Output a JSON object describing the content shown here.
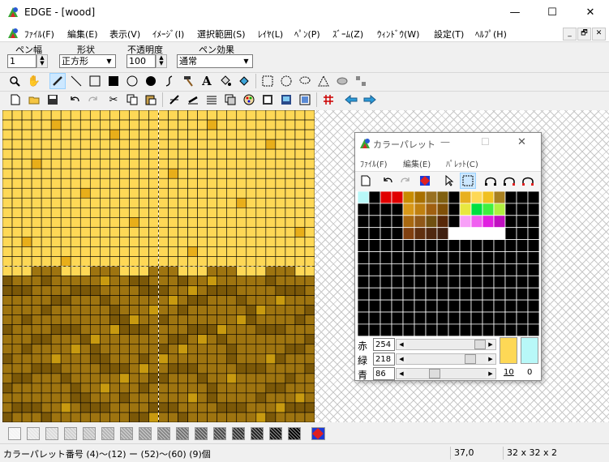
{
  "window": {
    "title": "EDGE - [wood]",
    "minimize_glyph": "—",
    "maximize_glyph": "☐",
    "close_glyph": "✕"
  },
  "menu": [
    "ﾌｧｲﾙ(F)",
    "編集(E)",
    "表示(V)",
    "ｲﾒｰｼﾞ(I)",
    "選択範囲(S)",
    "ﾚｲﾔ(L)",
    "ﾍﾟﾝ(P)",
    "ｽﾞｰﾑ(Z)",
    "ｳｨﾝﾄﾞｳ(W)",
    "設定(T)",
    "ﾍﾙﾌﾟ(H)"
  ],
  "mdi_buttons": [
    "_",
    "🗗",
    "✕"
  ],
  "settings": {
    "pen_width_label": "ペン幅",
    "pen_width_value": "1",
    "shape_label": "形状",
    "shape_value": "正方形",
    "opacity_label": "不透明度",
    "opacity_value": "100",
    "effect_label": "ペン効果",
    "effect_value": "通常"
  },
  "toolbar1_icons": [
    "zoom-icon",
    "hand-icon",
    "pencil-icon",
    "line-icon",
    "rect-outline-icon",
    "rect-fill-icon",
    "ellipse-outline-icon",
    "ellipse-fill-icon",
    "curve-icon",
    "hammer-icon",
    "text-icon",
    "bucket-icon",
    "fill-icon",
    "select-rect-icon",
    "select-ellipse-icon",
    "select-lasso-icon",
    "select-polygon-icon",
    "magic-wand-icon",
    "dotted-select-icon"
  ],
  "toolbar2_icons": [
    "new-file-icon",
    "open-file-icon",
    "save-icon",
    "undo-icon",
    "redo-icon",
    "cut-icon",
    "copy-icon",
    "paste-icon",
    "pen-icon",
    "brush-icon",
    "grid-icon",
    "layers-icon",
    "palette-icon",
    "film-icon",
    "image-icon",
    "frame-icon",
    "tile-grid-icon",
    "back-arrow-icon",
    "forward-arrow-icon"
  ],
  "palette_window": {
    "title": "カラーパレット",
    "menu": [
      "ﾌｧｲﾙ(F)",
      "編集(E)",
      "ﾊﾟﾚｯﾄ(C)"
    ],
    "rgb": [
      {
        "label": "赤",
        "value": "254",
        "level": 0.996
      },
      {
        "label": "緑",
        "value": "218",
        "level": 0.855
      },
      {
        "label": "青",
        "value": "86",
        "level": 0.337
      }
    ],
    "index_fg": "10",
    "index_bg": "0",
    "fg_color": "#fed856",
    "bg_color": "#b8f8f8"
  },
  "status": {
    "message": "カラーパレット番号 (4)〜(12) ー (52)〜(60) (9)個",
    "position": "37,0",
    "size": "32 x 32 x 2"
  },
  "colors": {
    "light_wood": "#fed856",
    "light_wood_knot": "#e8ae1a",
    "dark_wood": "#9e7410",
    "dark_wood_grain": "#7b5808",
    "dark_wood_spot": "#c89a10"
  }
}
